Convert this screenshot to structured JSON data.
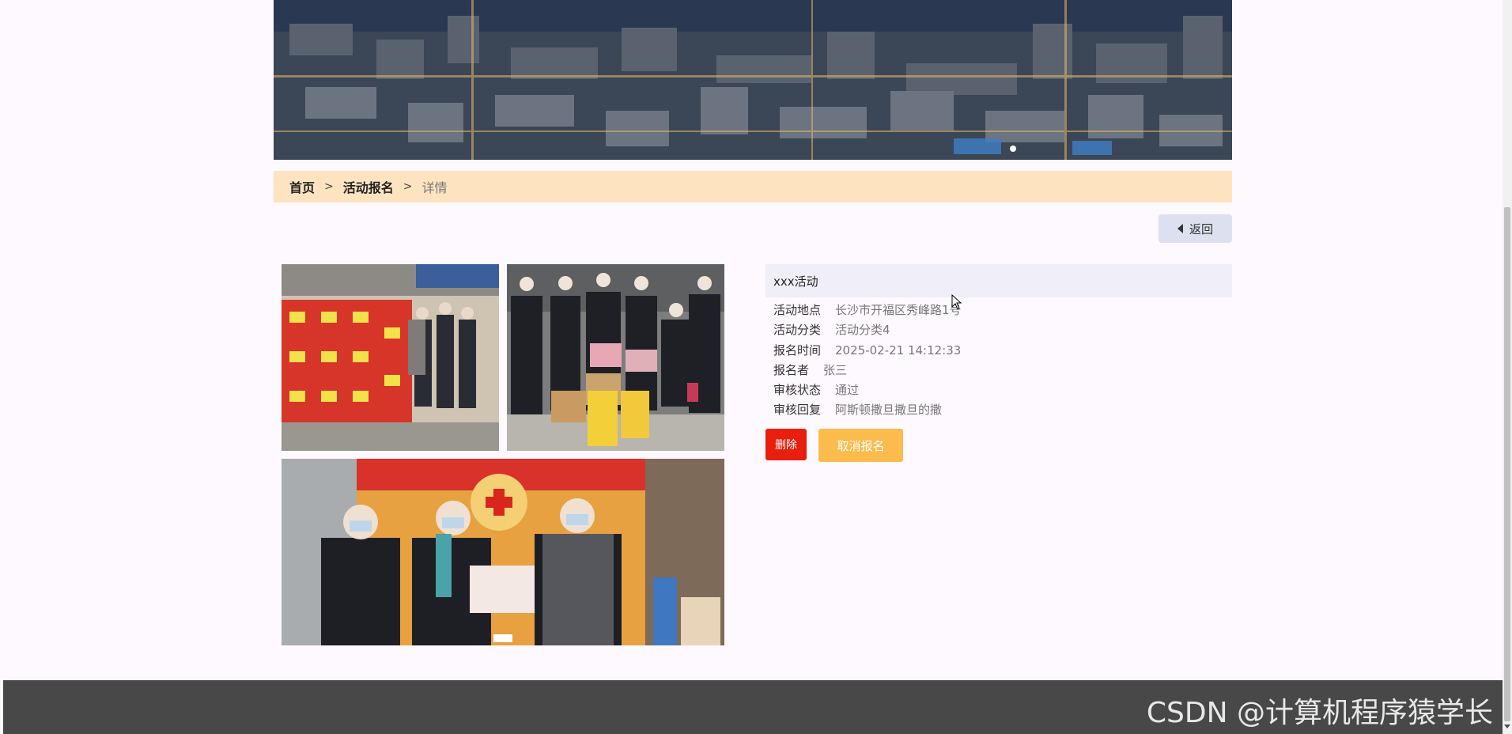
{
  "breadcrumb": {
    "home": "首页",
    "separator": ">",
    "section": "活动报名",
    "current": "详情"
  },
  "back_button": {
    "label": "返回",
    "icon": "caret-left-icon"
  },
  "activity": {
    "title": "xxx活动",
    "fields": [
      {
        "label": "活动地点",
        "value": "长沙市开福区秀峰路1号"
      },
      {
        "label": "活动分类",
        "value": "活动分类4"
      },
      {
        "label": "报名时间",
        "value": "2025-02-21 14:12:33"
      },
      {
        "label": "报名者",
        "value": "张三"
      },
      {
        "label": "审核状态",
        "value": "通过"
      },
      {
        "label": "审核回复",
        "value": "阿斯顿撒旦撒旦的撒"
      }
    ]
  },
  "actions": {
    "delete_label": "删除",
    "cancel_label": "取消报名"
  },
  "footer": {
    "watermark": "CSDN @计算机程序猿学长"
  },
  "colors": {
    "breadcrumb_bg": "#fde3c0",
    "delete_button": "#e81f0e",
    "cancel_button": "#fbbb4d",
    "footer_bg": "#484848",
    "title_bg": "#efeef9"
  }
}
